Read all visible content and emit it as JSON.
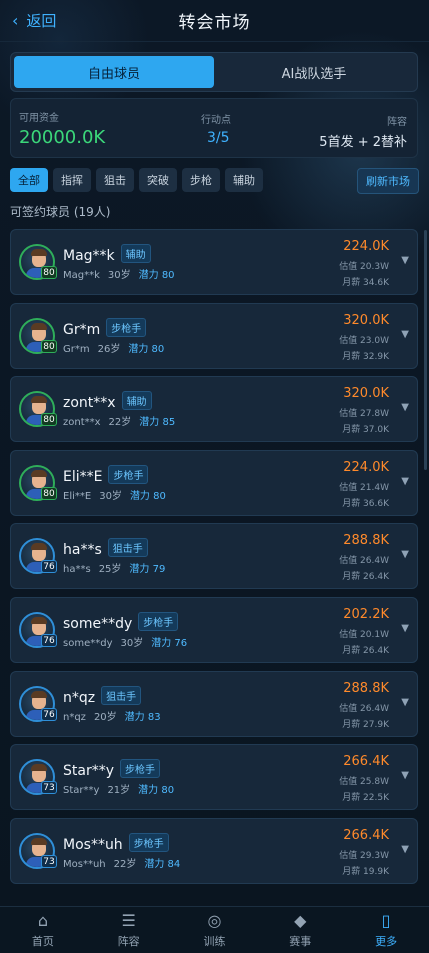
{
  "header": {
    "back_label": "返回",
    "back_icon": "chevron-left-icon",
    "title": "转会市场"
  },
  "tabs": [
    {
      "label": "自由球员",
      "active": true
    },
    {
      "label": "AI战队选手",
      "active": false
    }
  ],
  "stats": {
    "funds_label": "可用资金",
    "funds_value": "20000.0K",
    "ap_label": "行动点",
    "ap_value": "3/5",
    "lineup_label": "阵容",
    "lineup_value": "5首发 + 2替补"
  },
  "filters": [
    "全部",
    "指挥",
    "狙击",
    "突破",
    "步枪",
    "辅助"
  ],
  "refresh_label": "刷新市场",
  "count_label": "可签约球员 (19人)",
  "players": [
    {
      "name": "Mag**k",
      "position": "辅助",
      "sub_name": "Mag**k",
      "age": "30岁",
      "potential": "潜力 80",
      "ovr": "80",
      "price": "224.0K",
      "est": "估值 20.3W",
      "salary": "月薪 34.6K",
      "tier": "green"
    },
    {
      "name": "Gr*m",
      "position": "步枪手",
      "sub_name": "Gr*m",
      "age": "26岁",
      "potential": "潜力 80",
      "ovr": "80",
      "price": "320.0K",
      "est": "估值 23.0W",
      "salary": "月薪 32.9K",
      "tier": "green"
    },
    {
      "name": "zont**x",
      "position": "辅助",
      "sub_name": "zont**x",
      "age": "22岁",
      "potential": "潜力 85",
      "ovr": "80",
      "price": "320.0K",
      "est": "估值 27.8W",
      "salary": "月薪 37.0K",
      "tier": "green"
    },
    {
      "name": "Eli**E",
      "position": "步枪手",
      "sub_name": "Eli**E",
      "age": "30岁",
      "potential": "潜力 80",
      "ovr": "80",
      "price": "224.0K",
      "est": "估值 21.4W",
      "salary": "月薪 36.6K",
      "tier": "green"
    },
    {
      "name": "ha**s",
      "position": "狙击手",
      "sub_name": "ha**s",
      "age": "25岁",
      "potential": "潜力 79",
      "ovr": "76",
      "price": "288.8K",
      "est": "估值 26.4W",
      "salary": "月薪 26.4K",
      "tier": "blue"
    },
    {
      "name": "some**dy",
      "position": "步枪手",
      "sub_name": "some**dy",
      "age": "30岁",
      "potential": "潜力 76",
      "ovr": "76",
      "price": "202.2K",
      "est": "估值 20.1W",
      "salary": "月薪 26.4K",
      "tier": "blue"
    },
    {
      "name": "n*qz",
      "position": "狙击手",
      "sub_name": "n*qz",
      "age": "20岁",
      "potential": "潜力 83",
      "ovr": "76",
      "price": "288.8K",
      "est": "估值 26.4W",
      "salary": "月薪 27.9K",
      "tier": "blue"
    },
    {
      "name": "Star**y",
      "position": "步枪手",
      "sub_name": "Star**y",
      "age": "21岁",
      "potential": "潜力 80",
      "ovr": "73",
      "price": "266.4K",
      "est": "估值 25.8W",
      "salary": "月薪 22.5K",
      "tier": "blue"
    },
    {
      "name": "Mos**uh",
      "position": "步枪手",
      "sub_name": "Mos**uh",
      "age": "22岁",
      "potential": "潜力 84",
      "ovr": "73",
      "price": "266.4K",
      "est": "估值 29.3W",
      "salary": "月薪 19.9K",
      "tier": "blue"
    }
  ],
  "nav": [
    {
      "label": "首页",
      "icon": "home-icon",
      "active": false
    },
    {
      "label": "阵容",
      "icon": "roster-icon",
      "active": false
    },
    {
      "label": "训练",
      "icon": "training-icon",
      "active": false
    },
    {
      "label": "赛事",
      "icon": "tournament-icon",
      "active": false
    },
    {
      "label": "更多",
      "icon": "more-icon",
      "active": true
    }
  ],
  "colors": {
    "accent": "#2ea7f0",
    "funds": "#3bd77a",
    "price": "#ff8a2b"
  }
}
